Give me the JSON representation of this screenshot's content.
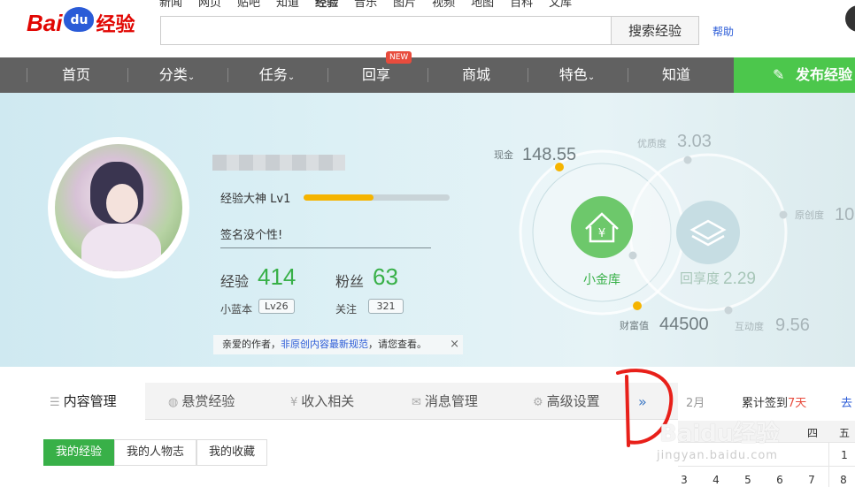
{
  "topnav": [
    "新闻",
    "网页",
    "贴吧",
    "知道",
    "经验",
    "音乐",
    "图片",
    "视频",
    "地图",
    "百科",
    "文库"
  ],
  "logo": {
    "bai": "Bai",
    "du": "du",
    "jingyan": "经验"
  },
  "search": {
    "value": "",
    "button": "搜索经验"
  },
  "help": "帮助",
  "mainnav": {
    "items": [
      "首页",
      "分类",
      "任务",
      "回享",
      "商城",
      "特色",
      "知道"
    ],
    "new_badge": "NEW",
    "publish": "发布经验"
  },
  "profile": {
    "level": "经验大神 Lv1",
    "level_progress": 0.48,
    "signature": "签名没个性!",
    "exp_label": "经验",
    "exp_value": "414",
    "fans_label": "粉丝",
    "fans_value": "63",
    "blue_label": "小蓝本",
    "blue_value": "Lv26",
    "follow_label": "关注",
    "follow_value": "321",
    "notice_pre": "亲爱的作者，",
    "notice_link": "非原创内容最新规范",
    "notice_post": "，请您查看。",
    "notice_close": "×"
  },
  "metrics": {
    "cash_label": "现金",
    "cash": "148.55",
    "quality_label": "优质度",
    "quality": "3.03",
    "original_label": "原创度",
    "original": "10",
    "vault": "小金库",
    "return_label": "回享度",
    "return_value": "2.29",
    "wealth_label": "财富值",
    "wealth": "44500",
    "interact_label": "互动度",
    "interact": "9.56"
  },
  "tabs": [
    "内容管理",
    "悬赏经验",
    "收入相关",
    "消息管理",
    "高级设置"
  ],
  "tabs_more": "»",
  "subtabs": [
    "我的经验",
    "我的人物志",
    "我的收藏"
  ],
  "calendar": {
    "month": "2月",
    "sign_pre": "累计签到",
    "sign_days": "7天",
    "go": "去",
    "headers": [
      "四",
      "五"
    ],
    "row1": [
      "1"
    ],
    "row2": [
      "3",
      "4",
      "5",
      "6",
      "7",
      "8"
    ]
  },
  "watermark": {
    "text": "Baidu经验",
    "url": "jingyan.baidu.com"
  },
  "colors": {
    "green": "#38b048",
    "nav": "#616161",
    "publish": "#4cc74c",
    "red": "#e10602",
    "blue": "#2a5bd7"
  }
}
